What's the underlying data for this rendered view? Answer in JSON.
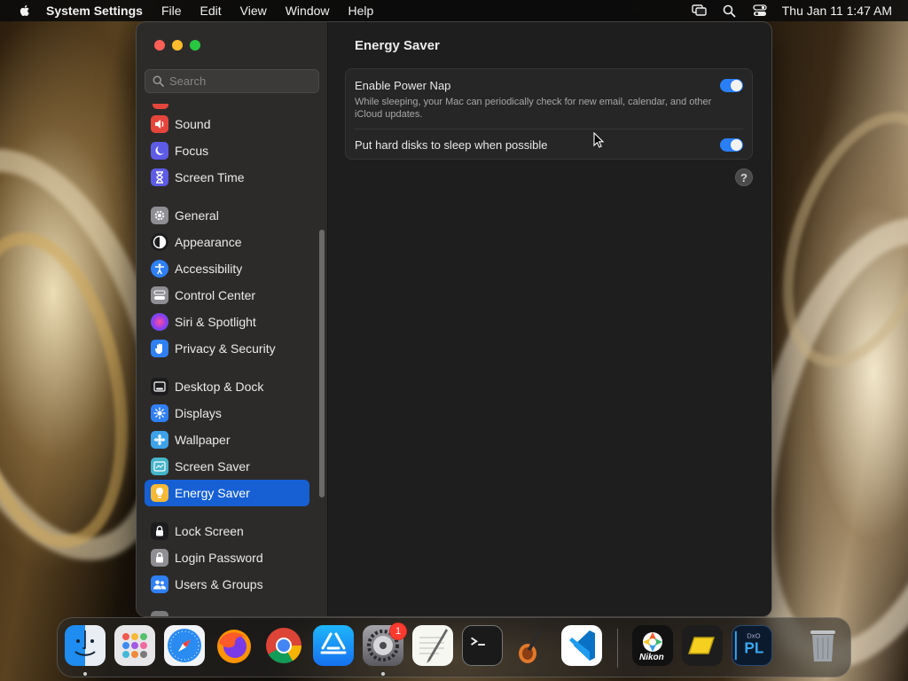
{
  "menubar": {
    "app_name": "System Settings",
    "menus": [
      "File",
      "Edit",
      "View",
      "Window",
      "Help"
    ],
    "clock": "Thu Jan 11  1:47 AM",
    "status_icons": [
      "screen-mirroring-icon",
      "spotlight-search-icon",
      "control-center-icon"
    ]
  },
  "sidebar": {
    "search_placeholder": "Search",
    "groups": [
      [
        {
          "label": "Sound",
          "icon": "sound-icon",
          "color": "#e5453b"
        },
        {
          "label": "Focus",
          "icon": "focus-moon-icon",
          "color": "#5e5ce6"
        },
        {
          "label": "Screen Time",
          "icon": "hourglass-icon",
          "color": "#5e5ce6"
        }
      ],
      [
        {
          "label": "General",
          "icon": "gear-icon",
          "color": "#8e8e93"
        },
        {
          "label": "Appearance",
          "icon": "appearance-icon",
          "color": "#1c1c1e"
        },
        {
          "label": "Accessibility",
          "icon": "accessibility-icon",
          "color": "#2f7ff5"
        },
        {
          "label": "Control Center",
          "icon": "control-center-icon",
          "color": "#8e8e93"
        },
        {
          "label": "Siri & Spotlight",
          "icon": "siri-icon",
          "color": "#b14ad8"
        },
        {
          "label": "Privacy & Security",
          "icon": "hand-icon",
          "color": "#2f7ff5"
        }
      ],
      [
        {
          "label": "Desktop & Dock",
          "icon": "dock-icon",
          "color": "#1c1c1e"
        },
        {
          "label": "Displays",
          "icon": "sun-icon",
          "color": "#2f7ff5"
        },
        {
          "label": "Wallpaper",
          "icon": "flower-icon",
          "color": "#3da2e8"
        },
        {
          "label": "Screen Saver",
          "icon": "screen-saver-icon",
          "color": "#45b5c9"
        },
        {
          "label": "Energy Saver",
          "icon": "lightbulb-icon",
          "color": "#f5b935",
          "selected": true
        }
      ],
      [
        {
          "label": "Lock Screen",
          "icon": "lock-icon",
          "color": "#1c1c1e"
        },
        {
          "label": "Login Password",
          "icon": "lock-icon",
          "color": "#8e8e93"
        },
        {
          "label": "Users & Groups",
          "icon": "users-icon",
          "color": "#2f7ff5"
        }
      ]
    ]
  },
  "content": {
    "title": "Energy Saver",
    "settings": [
      {
        "title": "Enable Power Nap",
        "description": "While sleeping, your Mac can periodically check for new email, calendar, and other iCloud updates.",
        "enabled": true
      },
      {
        "title": "Put hard disks to sleep when possible",
        "enabled": true
      }
    ],
    "help_label": "?"
  },
  "dock": {
    "apps": [
      {
        "name": "Finder",
        "icon": "finder-icon",
        "running": true
      },
      {
        "name": "Launchpad",
        "icon": "launchpad-icon"
      },
      {
        "name": "Safari",
        "icon": "safari-icon"
      },
      {
        "name": "Firefox",
        "icon": "firefox-icon"
      },
      {
        "name": "Chrome",
        "icon": "chrome-icon"
      },
      {
        "name": "App Store",
        "icon": "app-store-icon"
      },
      {
        "name": "System Settings",
        "icon": "system-settings-icon",
        "running": true,
        "badge": "1"
      },
      {
        "name": "TextEdit",
        "icon": "textedit-icon"
      },
      {
        "name": "Terminal",
        "icon": "terminal-icon"
      },
      {
        "name": "GarageBand",
        "icon": "garageband-icon"
      },
      {
        "name": "Visual Studio Code",
        "icon": "vscode-icon"
      },
      {
        "name": "Nikon",
        "icon": "nikon-icon",
        "label": "Nikon"
      },
      {
        "name": "Sketch-like app",
        "icon": "yellow-hexagon-icon"
      },
      {
        "name": "DxO PhotoLab",
        "icon": "photolab-icon",
        "label": "PL"
      },
      {
        "name": "Trash",
        "icon": "trash-icon"
      }
    ]
  }
}
